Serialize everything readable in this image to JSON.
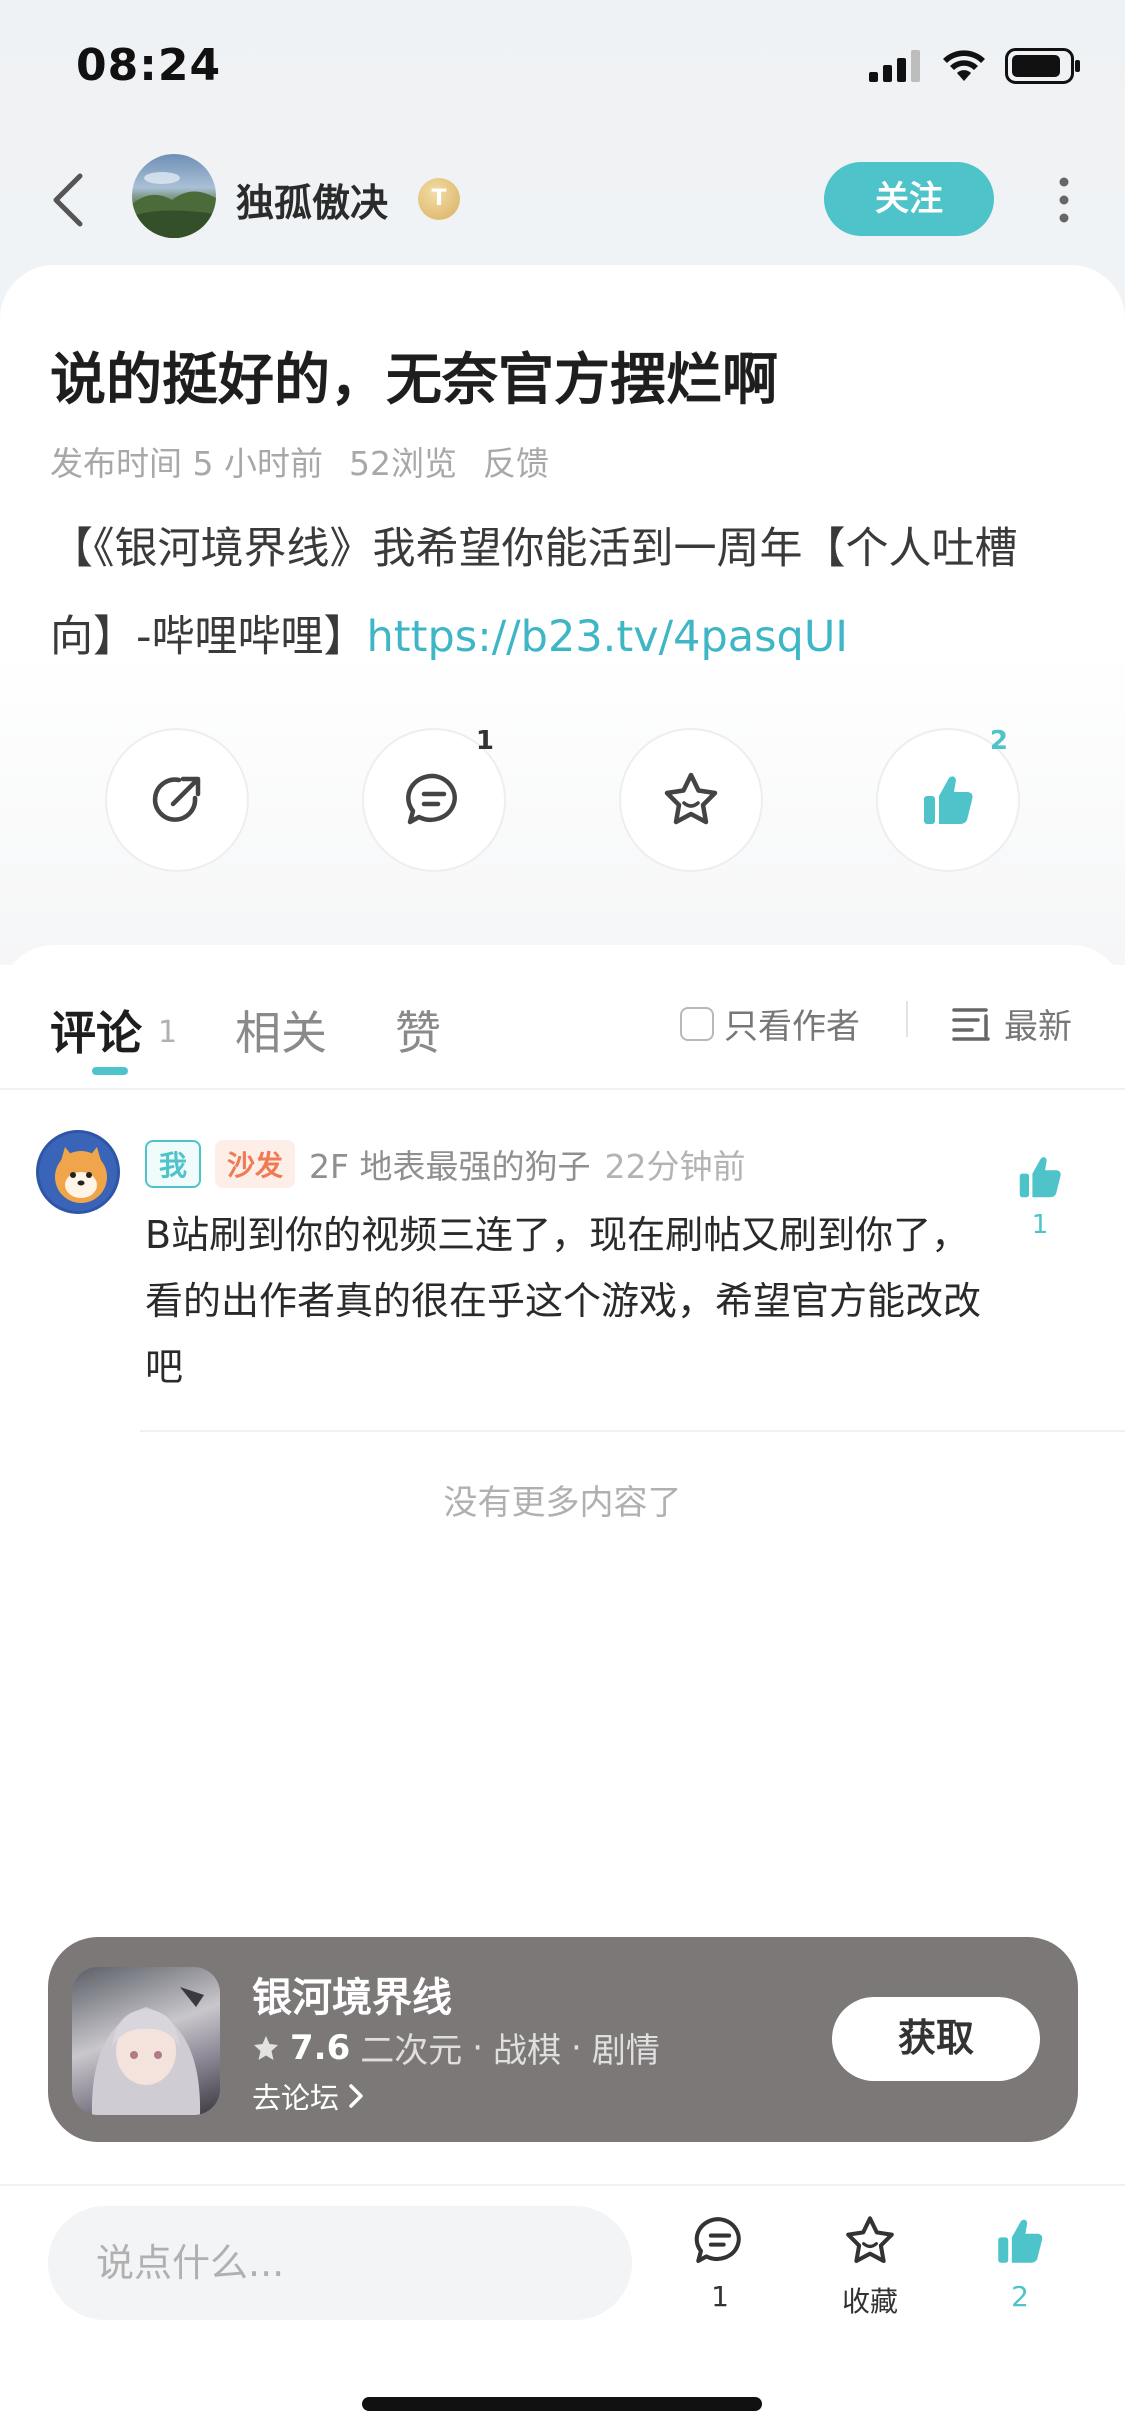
{
  "status_bar": {
    "time": "08:24"
  },
  "header": {
    "username": "独孤傲决",
    "badge": "T",
    "follow_label": "关注"
  },
  "post": {
    "title": "说的挺好的，无奈官方摆烂啊",
    "meta": {
      "publish": "发布时间 5 小时前",
      "views": "52浏览",
      "feedback": "反馈"
    },
    "body_text": "【《银河境界线》我希望你能活到一周年【个人吐槽向】-哔哩哔哩】",
    "link": "https://b23.tv/4pasqUI"
  },
  "actions": {
    "comment_count": "1",
    "like_count": "2"
  },
  "tabs": {
    "comments": "评论",
    "comments_count": "1",
    "related": "相关",
    "likes": "赞",
    "author_only": "只看作者",
    "sort": "最新"
  },
  "comment": {
    "tag_me": "我",
    "tag_sofa": "沙发",
    "floor_author": "2F 地表最强的狗子",
    "time": "22分钟前",
    "text": "B站刷到你的视频三连了，现在刷帖又刷到你了，看的出作者真的很在乎这个游戏，希望官方能改改吧",
    "like_count": "1"
  },
  "no_more": "没有更多内容了",
  "game": {
    "name": "银河境界线",
    "rating": "7.6",
    "tags": [
      "二次元",
      "战棋",
      "剧情"
    ],
    "forum_link": "去论坛",
    "get_label": "获取"
  },
  "bottom_bar": {
    "input_placeholder": "说点什么...",
    "comment_count": "1",
    "favorite_label": "收藏",
    "like_count": "2"
  },
  "colors": {
    "accent": "#4ec3c9",
    "sofa": "#ef7b55",
    "game_card": "#7c7878"
  }
}
